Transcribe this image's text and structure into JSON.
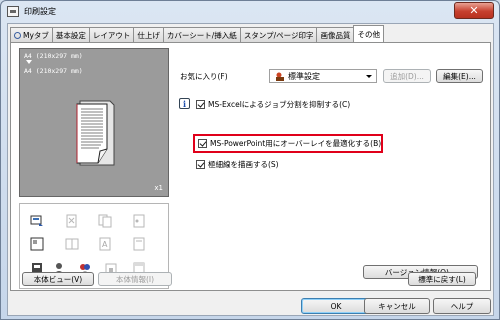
{
  "window": {
    "title": "印刷設定",
    "close_glyph": "✕"
  },
  "tabs": [
    {
      "label": "Myタブ",
      "icon": "magnifier-icon"
    },
    {
      "label": "基本設定"
    },
    {
      "label": "レイアウト"
    },
    {
      "label": "仕上げ"
    },
    {
      "label": "カバーシート/挿入紙"
    },
    {
      "label": "スタンプ/ページ印字"
    },
    {
      "label": "画像品質"
    },
    {
      "label": "その他",
      "active": true
    }
  ],
  "preview": {
    "line1": "A4 (210x297 mm)",
    "line2": "A4 (210x297 mm)",
    "copies": "x1"
  },
  "left_buttons": {
    "printer_view": "本体ビュー(V)",
    "printer_info": "本体情報(I)"
  },
  "favorites": {
    "label": "お気に入り(F)",
    "selected": "標準設定",
    "add_button": "追加(D)...",
    "edit_button": "編集(E)..."
  },
  "options": [
    {
      "label": "MS-Excelによるジョブ分割を抑制する(C)",
      "checked": true
    },
    {
      "label": "MS-PowerPoint用にオーバーレイを最適化する(B)",
      "checked": true,
      "highlighted": true
    },
    {
      "label": "極細線を描画する(S)",
      "checked": true
    }
  ],
  "version_button": "バージョン情報(O)...",
  "default_button": "標準に戻す(L)",
  "footer": {
    "ok": "OK",
    "cancel": "キャンセル",
    "help": "ヘルプ"
  },
  "colors": {
    "highlight_border": "#e0001a",
    "preview_bg": "#9b9b9b",
    "title_gradient_top": "#dbe6f3"
  }
}
